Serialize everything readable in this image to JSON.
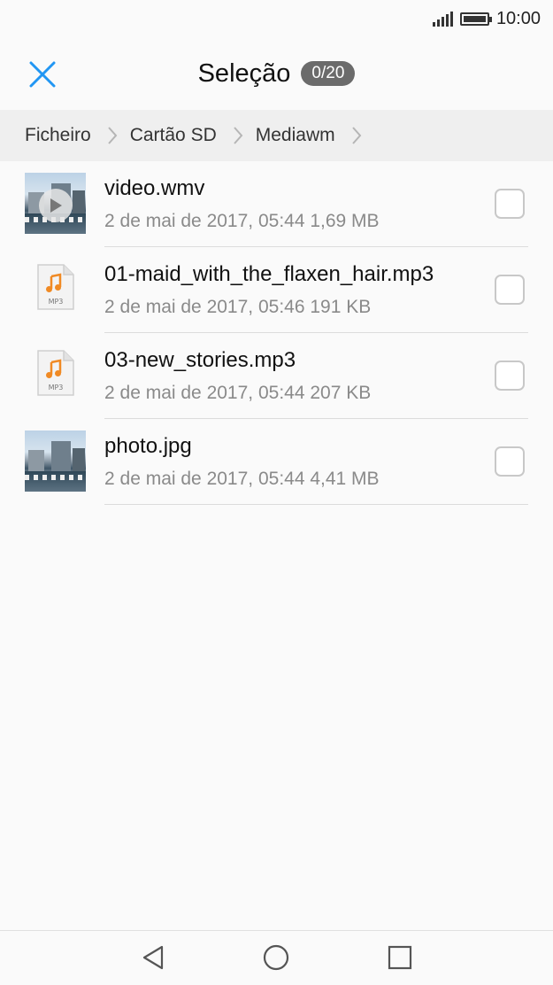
{
  "status_bar": {
    "time": "10:00",
    "signal_icon": "signal-bars-icon",
    "battery_icon": "battery-full-icon"
  },
  "header": {
    "close_icon": "close-icon",
    "title": "Seleção",
    "selection_count": "0/20",
    "accent_color": "#2196f3"
  },
  "breadcrumb": {
    "items": [
      "Ficheiro",
      "Cartão SD",
      "Mediawm"
    ],
    "separator_icon": "chevron-right-icon"
  },
  "files": [
    {
      "name": "video.wmv",
      "meta": "2 de mai de 2017, 05:44 1,69 MB",
      "type": "video",
      "icon": "video-thumbnail",
      "checked": false
    },
    {
      "name": "01-maid_with_the_flaxen_hair.mp3",
      "meta": "2 de mai de 2017, 05:46 191 KB",
      "type": "audio",
      "icon": "mp3-file-icon",
      "icon_label": "MP3",
      "checked": false
    },
    {
      "name": "03-new_stories.mp3",
      "meta": "2 de mai de 2017, 05:44 207 KB",
      "type": "audio",
      "icon": "mp3-file-icon",
      "icon_label": "MP3",
      "checked": false
    },
    {
      "name": "photo.jpg",
      "meta": "2 de mai de 2017, 05:44 4,41 MB",
      "type": "image",
      "icon": "photo-thumbnail",
      "checked": false
    }
  ],
  "nav_bar": {
    "back_icon": "back-triangle-icon",
    "home_icon": "home-circle-icon",
    "recent_icon": "recent-apps-square-icon"
  }
}
